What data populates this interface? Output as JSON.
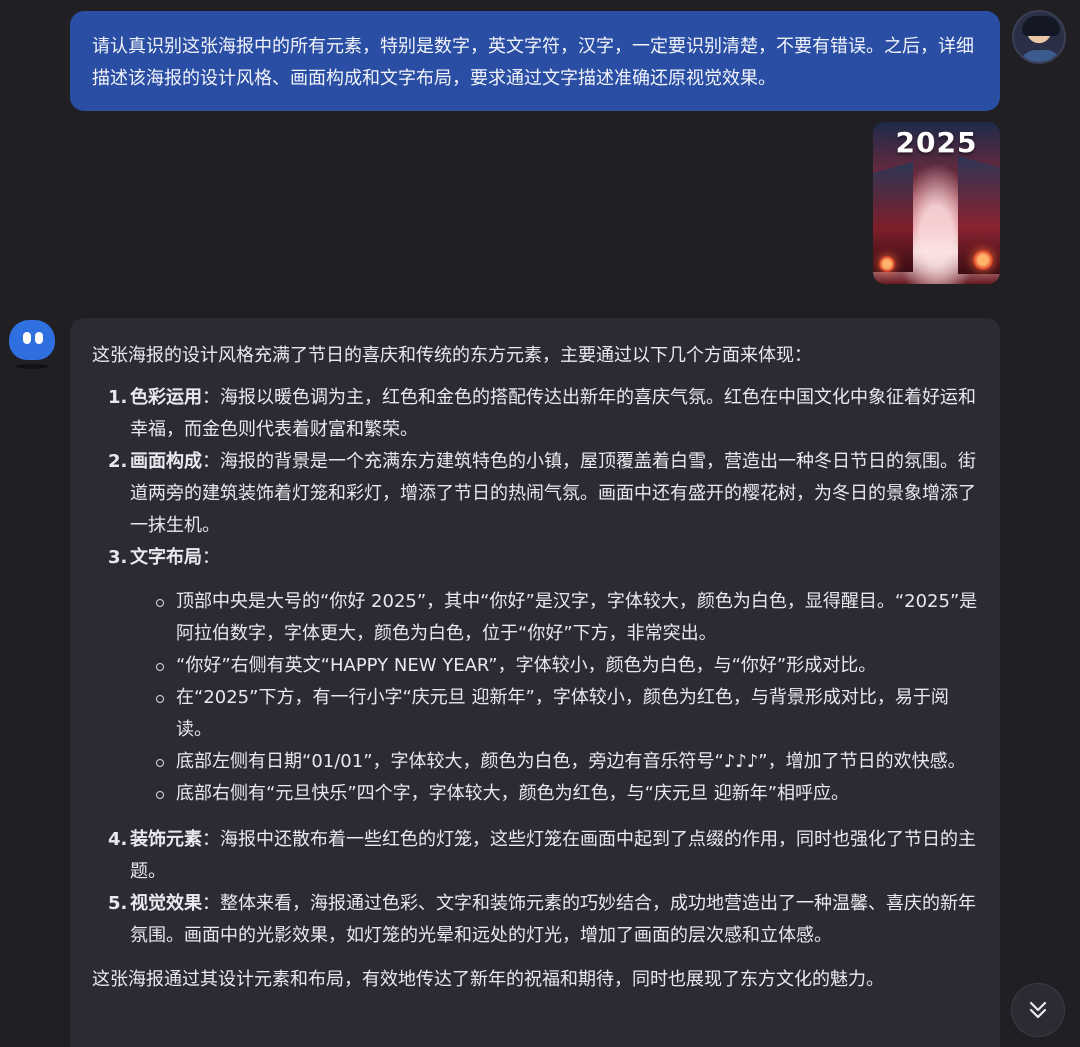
{
  "user_message": {
    "text": "请认真识别这张海报中的所有元素，特别是数字，英文字符，汉字，一定要识别清楚，不要有错误。之后，详细描述该海报的设计风格、画面构成和文字布局，要求通过文字描述准确还原视觉效果。"
  },
  "attachment": {
    "poster_text": "2025"
  },
  "assistant": {
    "intro": "这张海报的设计风格充满了节日的喜庆和传统的东方元素，主要通过以下几个方面来体现：",
    "items": [
      {
        "num": "1.",
        "title": "色彩运用",
        "body": "：海报以暖色调为主，红色和金色的搭配传达出新年的喜庆气氛。红色在中国文化中象征着好运和幸福，而金色则代表着财富和繁荣。"
      },
      {
        "num": "2.",
        "title": "画面构成",
        "body": "：海报的背景是一个充满东方建筑特色的小镇，屋顶覆盖着白雪，营造出一种冬日节日的氛围。街道两旁的建筑装饰着灯笼和彩灯，增添了节日的热闹气氛。画面中还有盛开的樱花树，为冬日的景象增添了一抹生机。"
      },
      {
        "num": "3.",
        "title": "文字布局",
        "body": "：",
        "subitems": [
          "顶部中央是大号的“你好 2025”，其中“你好”是汉字，字体较大，颜色为白色，显得醒目。“2025”是阿拉伯数字，字体更大，颜色为白色，位于“你好”下方，非常突出。",
          "“你好”右侧有英文“HAPPY NEW YEAR”，字体较小，颜色为白色，与“你好”形成对比。",
          "在“2025”下方，有一行小字“庆元旦 迎新年”，字体较小，颜色为红色，与背景形成对比，易于阅读。",
          "底部左侧有日期“01/01”，字体较大，颜色为白色，旁边有音乐符号“♪♪♪”，增加了节日的欢快感。",
          "底部右侧有“元旦快乐”四个字，字体较大，颜色为红色，与“庆元旦 迎新年”相呼应。"
        ]
      },
      {
        "num": "4.",
        "title": "装饰元素",
        "body": "：海报中还散布着一些红色的灯笼，这些灯笼在画面中起到了点缀的作用，同时也强化了节日的主题。"
      },
      {
        "num": "5.",
        "title": "视觉效果",
        "body": "：整体来看，海报通过色彩、文字和装饰元素的巧妙结合，成功地营造出了一种温馨、喜庆的新年氛围。画面中的光影效果，如灯笼的光晕和远处的灯光，增加了画面的层次感和立体感。"
      }
    ],
    "closing": "这张海报通过其设计元素和布局，有效地传达了新年的祝福和期待，同时也展现了东方文化的魅力。"
  },
  "icons": {
    "scroll": "chevron-double-down-icon",
    "bot": "bot-avatar-icon",
    "user": "user-avatar"
  },
  "colors": {
    "background": "#1f1f24",
    "user_bubble": "#2a4ea3",
    "assistant_bubble": "#2b2c33",
    "bot_avatar": "#2f6fe0"
  }
}
